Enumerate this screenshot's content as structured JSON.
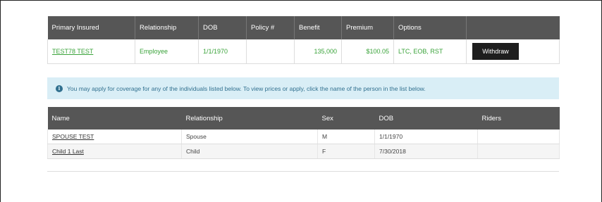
{
  "primary_table": {
    "headers": [
      "Primary Insured",
      "Relationship",
      "DOB",
      "Policy #",
      "Benefit",
      "Premium",
      "Options",
      ""
    ],
    "row": {
      "name": "TEST78 TEST",
      "relationship": "Employee",
      "dob": "1/1/1970",
      "policy": "",
      "benefit": "135,000",
      "premium": "$100.05",
      "options": "LTC, EOB, RST",
      "action_label": "Withdraw"
    }
  },
  "info_alert": {
    "icon": "info-icon",
    "text": "You may apply for coverage for any of the individuals listed below. To view prices or apply, click the name of the person in the list below."
  },
  "people_table": {
    "headers": [
      "Name",
      "Relationship",
      "Sex",
      "DOB",
      "Riders"
    ],
    "rows": [
      {
        "name": "SPOUSE TEST",
        "relationship": "Spouse",
        "sex": "M",
        "dob": "1/1/1970",
        "riders": ""
      },
      {
        "name": "Child 1 Last",
        "relationship": "Child",
        "sex": "F",
        "dob": "7/30/2018",
        "riders": ""
      }
    ]
  },
  "colors": {
    "header_bg": "#565656",
    "primary_text": "#3aa33a",
    "info_bg": "#d9eef6",
    "info_text": "#31708f",
    "button_bg": "#1e1e1e"
  }
}
